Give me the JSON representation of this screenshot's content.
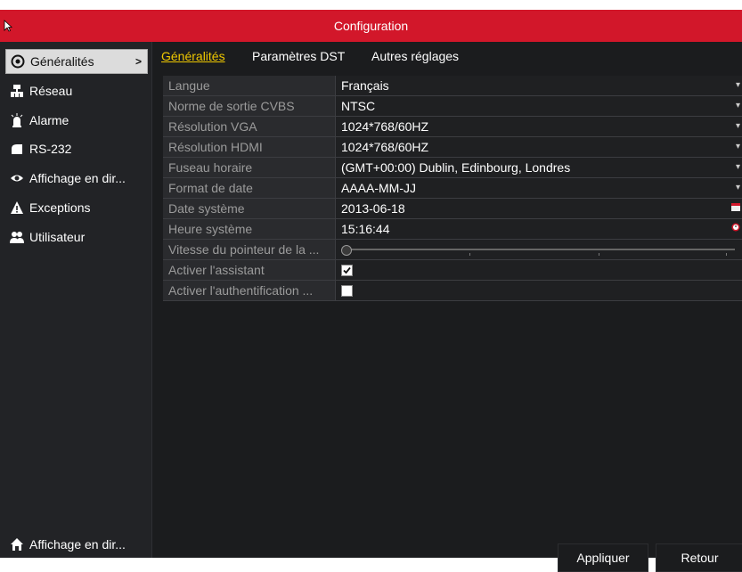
{
  "window": {
    "title": "Configuration"
  },
  "sidebar": {
    "items": [
      {
        "label": "Généralités",
        "icon": "gear-icon",
        "active": true,
        "chevron": ">"
      },
      {
        "label": "Réseau",
        "icon": "network-icon"
      },
      {
        "label": "Alarme",
        "icon": "alarm-icon"
      },
      {
        "label": "RS-232",
        "icon": "serial-icon"
      },
      {
        "label": "Affichage en dir...",
        "icon": "eye-icon"
      },
      {
        "label": "Exceptions",
        "icon": "warning-icon"
      },
      {
        "label": "Utilisateur",
        "icon": "users-icon"
      }
    ],
    "bottom": {
      "label": "Affichage en dir...",
      "icon": "home-icon"
    }
  },
  "tabs": [
    {
      "label": "Généralités",
      "active": true
    },
    {
      "label": "Paramètres DST"
    },
    {
      "label": "Autres réglages"
    }
  ],
  "settings": [
    {
      "label": "Langue",
      "value": "Français",
      "control": "dropdown"
    },
    {
      "label": "Norme de sortie CVBS",
      "value": "NTSC",
      "control": "dropdown"
    },
    {
      "label": "Résolution VGA",
      "value": "1024*768/60HZ",
      "control": "dropdown"
    },
    {
      "label": "Résolution HDMI",
      "value": "1024*768/60HZ",
      "control": "dropdown"
    },
    {
      "label": "Fuseau horaire",
      "value": "(GMT+00:00) Dublin, Edinbourg, Londres",
      "control": "dropdown"
    },
    {
      "label": "Format de date",
      "value": "AAAA-MM-JJ",
      "control": "dropdown"
    },
    {
      "label": "Date système",
      "value": "2013-06-18",
      "control": "calendar"
    },
    {
      "label": "Heure système",
      "value": "15:16:44",
      "control": "clock"
    },
    {
      "label": "Vitesse du pointeur de la ...",
      "control": "slider"
    },
    {
      "label": "Activer l'assistant",
      "control": "checkbox",
      "checked": true
    },
    {
      "label": "Activer l'authentification ...",
      "control": "checkbox",
      "checked": false
    }
  ],
  "buttons": {
    "apply": "Appliquer",
    "back": "Retour"
  },
  "colors": {
    "titlebar": "#d2172a",
    "active_tab": "#f0c800",
    "background": "#1b1c1e"
  }
}
